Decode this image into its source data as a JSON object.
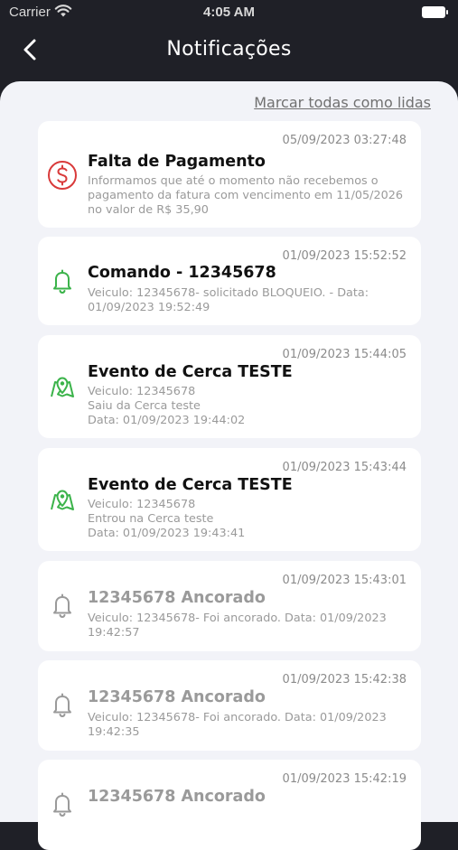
{
  "status": {
    "carrier": "Carrier",
    "time": "4:05 AM"
  },
  "nav": {
    "title": "Notificações"
  },
  "mark_all_label": "Marcar todas como lidas",
  "notifications": [
    {
      "date": "05/09/2023 03:27:48",
      "title": "Falta de Pagamento",
      "lines": [
        "Informamos que até o momento não recebemos o",
        "pagamento da fatura com vencimento em 11/05/2026",
        "no valor de R$ 35,90"
      ],
      "icon": "dollar-icon",
      "color": "#d93a3a"
    },
    {
      "date": "01/09/2023 15:52:52",
      "title": "Comando -  12345678",
      "lines": [
        "Veiculo: 12345678- solicitado BLOQUEIO. - Data:",
        "01/09/2023 19:52:49"
      ],
      "icon": "bell-icon",
      "color": "#3bb34a"
    },
    {
      "date": "01/09/2023 15:44:05",
      "title": "Evento de Cerca TESTE",
      "lines": [
        "Veiculo: 12345678",
        "Saiu da Cerca teste",
        "Data: 01/09/2023 19:44:02"
      ],
      "icon": "map-pin-icon",
      "color": "#3bb34a"
    },
    {
      "date": "01/09/2023 15:43:44",
      "title": "Evento de Cerca TESTE",
      "lines": [
        "Veiculo: 12345678",
        "Entrou na Cerca teste",
        "Data: 01/09/2023 19:43:41"
      ],
      "icon": "map-pin-icon",
      "color": "#3bb34a"
    },
    {
      "date": "01/09/2023 15:43:01",
      "title": "12345678 Ancorado",
      "lines": [
        "Veiculo: 12345678- Foi ancorado.  Data: 01/09/2023",
        "19:42:57"
      ],
      "icon": "bell-icon",
      "color": "#9a9a9a"
    },
    {
      "date": "01/09/2023 15:42:38",
      "title": "12345678 Ancorado",
      "lines": [
        "Veiculo: 12345678- Foi ancorado.  Data: 01/09/2023",
        "19:42:35"
      ],
      "icon": "bell-icon",
      "color": "#9a9a9a"
    },
    {
      "date": "01/09/2023 15:42:19",
      "title": "12345678 Ancorado",
      "lines": [
        ""
      ],
      "icon": "bell-icon",
      "color": "#9a9a9a"
    }
  ]
}
